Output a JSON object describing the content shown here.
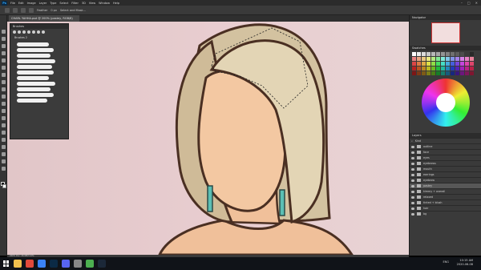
{
  "app": {
    "logo_text": "Ps"
  },
  "menubar": {
    "items": [
      "File",
      "Edit",
      "Image",
      "Layer",
      "Type",
      "Select",
      "Filter",
      "3D",
      "View",
      "Window",
      "Help"
    ],
    "controls": [
      "–",
      "□",
      "✕"
    ]
  },
  "options": {
    "feather_label": "Feather",
    "feather_value": "0 px",
    "select_mask": "Select and Mask..."
  },
  "document": {
    "tab_label": "CHARL YAHHA.psd @ 200% (pastey, RGB/8)"
  },
  "brushes_panel": {
    "title": "Brushes",
    "folder_name": "Brushes 2"
  },
  "right_panel": {
    "navigator_tab": "Navigator",
    "swatches_tab": "Swatches",
    "layers_tab": "Layers",
    "layers_search": "Kind",
    "layers": [
      {
        "name": "outline",
        "type": "layer",
        "active": false
      },
      {
        "name": "face",
        "type": "folder",
        "active": false
      },
      {
        "name": "eyes",
        "type": "folder",
        "active": false
      },
      {
        "name": "eyebrows",
        "type": "folder",
        "active": false
      },
      {
        "name": "mouth",
        "type": "folder",
        "active": false
      },
      {
        "name": "earrings",
        "type": "folder",
        "active": false
      },
      {
        "name": "eyebrow",
        "type": "folder",
        "active": false
      },
      {
        "name": "pastey",
        "type": "folder",
        "active": true
      },
      {
        "name": "kimmy + overall",
        "type": "folder",
        "active": false
      },
      {
        "name": "relaxed",
        "type": "folder",
        "active": false
      },
      {
        "name": "tinted + blush",
        "type": "folder",
        "active": false
      },
      {
        "name": "hair",
        "type": "layer",
        "active": false
      },
      {
        "name": "bg",
        "type": "layer",
        "active": false
      }
    ]
  },
  "status": {
    "text": "200%   Doc: 26.9M/3.47G"
  },
  "taskbar": {
    "time": "10:15 AM",
    "date": "2020-06-08",
    "tray_text": "ENG",
    "apps": [
      {
        "name": "file-explorer",
        "color": "#f2c14e"
      },
      {
        "name": "browser",
        "color": "#e24a3b"
      },
      {
        "name": "player",
        "color": "#3b82f6"
      },
      {
        "name": "photoshop",
        "color": "#0b2a45"
      },
      {
        "name": "discord",
        "color": "#5865f2"
      },
      {
        "name": "settings",
        "color": "#888888"
      },
      {
        "name": "chrome",
        "color": "#4caf50"
      },
      {
        "name": "steam",
        "color": "#1b2838"
      }
    ]
  },
  "colors": {
    "canvas_bg": "#e7ccce",
    "hair": "#d8c8a8",
    "skin": "#f3c8a2",
    "outline": "#4a2f22",
    "earring": "#5bbfb4"
  }
}
